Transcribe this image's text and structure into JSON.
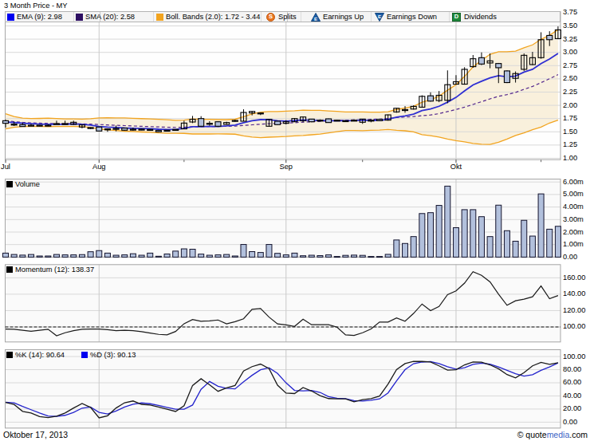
{
  "title": "3 Month Price - MY",
  "price_legend": {
    "ema": {
      "label": "EMA (9): 2.98",
      "color": "#0000f0"
    },
    "sma": {
      "label": "SMA (20): 2.58",
      "color": "#2d0e62"
    },
    "boll": {
      "label": "Boll. Bands (2.0): 1.72 - 3.44",
      "color": "#f2a41f"
    },
    "splits": {
      "label": "Splits"
    },
    "earnings_up": {
      "label": "Earnings Up"
    },
    "earnings_down": {
      "label": "Earnings Down"
    },
    "dividends": {
      "label": "Dividends"
    }
  },
  "footer": {
    "date": "Oktober 17, 2013",
    "copyright": "© ",
    "brand_pre": "quote",
    "brand_mid": "media",
    "brand_post": ".com"
  },
  "colors": {
    "ema_line": "#2f2fd3",
    "sma_line": "#53278d",
    "band_line": "#f2a41f",
    "band_fill": "#f9f0dc",
    "candle_stroke": "#000000",
    "candle_down_fill": "#b2c0dc",
    "volume_fill": "#b2c0dc",
    "volume_stroke": "#14142e",
    "momentum_line": "#1a1a1a",
    "pk_line": "#1a1a1a",
    "pd_line": "#2323cc",
    "grid": "#d9d9d9",
    "month_grid": "#c9c9c9",
    "panel_border": "#a6a6a6"
  },
  "x_axis": {
    "months": [
      {
        "label": "Jul",
        "index": 0
      },
      {
        "label": "Aug",
        "index": 11
      },
      {
        "label": "Sep",
        "index": 33
      },
      {
        "label": "Okt",
        "index": 53
      }
    ],
    "minor_tick_indices": [
      21,
      42,
      63
    ]
  },
  "chart_data": [
    {
      "id": "price",
      "type": "candlestick",
      "title": "3 Month Price - MY",
      "ylim": [
        0.974,
        3.771
      ],
      "yticks": [
        {
          "v": 3.75,
          "label": "3.75"
        },
        {
          "v": 3.5,
          "label": "3.50"
        },
        {
          "v": 3.25,
          "label": "3.25"
        },
        {
          "v": 3.0,
          "label": "3.00"
        },
        {
          "v": 2.75,
          "label": "2.75"
        },
        {
          "v": 2.5,
          "label": "2.50"
        },
        {
          "v": 2.25,
          "label": "2.25"
        },
        {
          "v": 2.0,
          "label": "2.00"
        },
        {
          "v": 1.75,
          "label": "1.75"
        },
        {
          "v": 1.5,
          "label": "1.50"
        },
        {
          "v": 1.25,
          "label": "1.25"
        },
        {
          "v": 1.0,
          "label": "1.00"
        }
      ],
      "ohlc": [
        [
          1.71,
          1.73,
          1.58,
          1.66
        ],
        [
          1.645,
          1.69,
          1.61,
          1.64
        ],
        [
          1.635,
          1.67,
          1.6,
          1.6
        ],
        [
          1.625,
          1.65,
          1.61,
          1.62
        ],
        [
          1.625,
          1.63,
          1.605,
          1.615
        ],
        [
          1.62,
          1.64,
          1.61,
          1.625
        ],
        [
          1.655,
          1.71,
          1.64,
          1.648
        ],
        [
          1.648,
          1.71,
          1.64,
          1.655
        ],
        [
          1.64,
          1.71,
          1.63,
          1.68
        ],
        [
          1.59,
          1.635,
          1.565,
          1.63
        ],
        [
          1.58,
          1.585,
          1.55,
          1.57
        ],
        [
          1.59,
          1.595,
          1.51,
          1.515
        ],
        [
          1.555,
          1.56,
          1.5,
          1.54
        ],
        [
          1.565,
          1.62,
          1.51,
          1.555
        ],
        [
          1.57,
          1.58,
          1.52,
          1.53
        ],
        [
          1.55,
          1.58,
          1.52,
          1.545
        ],
        [
          1.55,
          1.555,
          1.53,
          1.54
        ],
        [
          1.545,
          1.55,
          1.53,
          1.54
        ],
        [
          1.525,
          1.53,
          1.495,
          1.5
        ],
        [
          1.53,
          1.535,
          1.51,
          1.52
        ],
        [
          1.545,
          1.55,
          1.53,
          1.54
        ],
        [
          1.555,
          1.71,
          1.55,
          1.665
        ],
        [
          1.685,
          1.8,
          1.665,
          1.735
        ],
        [
          1.75,
          1.795,
          1.6,
          1.605
        ],
        [
          1.66,
          1.7,
          1.615,
          1.65
        ],
        [
          1.69,
          1.7,
          1.6,
          1.605
        ],
        [
          1.64,
          1.69,
          1.635,
          1.675
        ],
        [
          1.71,
          1.73,
          1.69,
          1.715
        ],
        [
          1.7,
          1.925,
          1.7,
          1.865
        ],
        [
          1.855,
          1.89,
          1.81,
          1.885
        ],
        [
          1.856,
          1.86,
          1.816,
          1.842
        ],
        [
          1.605,
          1.74,
          1.6,
          1.735
        ],
        [
          1.7,
          1.705,
          1.625,
          1.635
        ],
        [
          1.66,
          1.72,
          1.64,
          1.69
        ],
        [
          1.69,
          1.76,
          1.685,
          1.75
        ],
        [
          1.71,
          1.79,
          1.68,
          1.78
        ],
        [
          1.74,
          1.745,
          1.68,
          1.69
        ],
        [
          1.72,
          1.735,
          1.7,
          1.715
        ],
        [
          1.745,
          1.75,
          1.67,
          1.675
        ],
        [
          1.715,
          1.73,
          1.7,
          1.72
        ],
        [
          1.71,
          1.72,
          1.69,
          1.705
        ],
        [
          1.715,
          1.735,
          1.7,
          1.72
        ],
        [
          1.68,
          1.745,
          1.65,
          1.74
        ],
        [
          1.72,
          1.74,
          1.68,
          1.715
        ],
        [
          1.735,
          1.74,
          1.7,
          1.71
        ],
        [
          1.72,
          1.825,
          1.71,
          1.82
        ],
        [
          1.875,
          1.95,
          1.86,
          1.945
        ],
        [
          1.92,
          1.985,
          1.86,
          1.905
        ],
        [
          1.93,
          2.0,
          1.92,
          1.98
        ],
        [
          1.965,
          2.19,
          1.96,
          2.17
        ],
        [
          2.18,
          2.245,
          2.07,
          2.08
        ],
        [
          2.09,
          2.27,
          2.06,
          2.19
        ],
        [
          2.095,
          2.66,
          2.04,
          2.39
        ],
        [
          2.4,
          2.57,
          2.395,
          2.445
        ],
        [
          2.4,
          2.72,
          2.39,
          2.68
        ],
        [
          2.73,
          2.95,
          2.71,
          2.88
        ],
        [
          2.9,
          3.0,
          2.76,
          2.78
        ],
        [
          2.8,
          2.98,
          2.7,
          2.84
        ],
        [
          2.79,
          2.8,
          2.42,
          2.71
        ],
        [
          2.65,
          2.66,
          2.42,
          2.43
        ],
        [
          2.51,
          2.64,
          2.43,
          2.6
        ],
        [
          2.68,
          2.98,
          2.65,
          2.945
        ],
        [
          2.77,
          3.01,
          2.76,
          2.9
        ],
        [
          2.9,
          3.38,
          2.88,
          3.24
        ],
        [
          3.32,
          3.4,
          3.12,
          3.24
        ],
        [
          3.26,
          3.49,
          3.25,
          3.425
        ]
      ],
      "series": [
        {
          "name": "EMA (9)",
          "values": [
            1.685,
            1.677,
            1.662,
            1.654,
            1.646,
            1.641,
            1.641,
            1.643,
            1.648,
            1.643,
            1.625,
            1.6,
            1.588,
            1.582,
            1.572,
            1.567,
            1.563,
            1.56,
            1.549,
            1.545,
            1.543,
            1.566,
            1.597,
            1.596,
            1.604,
            1.601,
            1.612,
            1.628,
            1.671,
            1.709,
            1.73,
            1.729,
            1.708,
            1.703,
            1.711,
            1.724,
            1.716,
            1.716,
            1.708,
            1.71,
            1.71,
            1.713,
            1.72,
            1.718,
            1.715,
            1.735,
            1.776,
            1.8,
            1.834,
            1.9,
            1.933,
            1.982,
            2.06,
            2.15,
            2.272,
            2.386,
            2.455,
            2.52,
            2.56,
            2.537,
            2.553,
            2.629,
            2.68,
            2.788,
            2.875,
            2.98
          ]
        },
        {
          "name": "SMA (20)",
          "values": [
            1.707,
            1.692,
            1.678,
            1.67,
            1.663,
            1.659,
            1.655,
            1.653,
            1.652,
            1.65,
            1.645,
            1.637,
            1.629,
            1.623,
            1.617,
            1.61,
            1.603,
            1.599,
            1.592,
            1.587,
            1.583,
            1.586,
            1.595,
            1.596,
            1.6,
            1.601,
            1.604,
            1.609,
            1.62,
            1.632,
            1.644,
            1.654,
            1.657,
            1.663,
            1.672,
            1.683,
            1.689,
            1.697,
            1.704,
            1.713,
            1.72,
            1.725,
            1.727,
            1.735,
            1.74,
            1.752,
            1.768,
            1.78,
            1.787,
            1.804,
            1.818,
            1.843,
            1.882,
            1.922,
            1.966,
            2.017,
            2.069,
            2.122,
            2.17,
            2.202,
            2.244,
            2.302,
            2.357,
            2.429,
            2.503,
            2.58
          ]
        },
        {
          "name": "Bollinger Upper",
          "values": [
            1.84,
            1.79,
            1.759,
            1.751,
            1.753,
            1.757,
            1.75,
            1.744,
            1.743,
            1.741,
            1.748,
            1.763,
            1.764,
            1.761,
            1.762,
            1.755,
            1.749,
            1.743,
            1.737,
            1.728,
            1.717,
            1.72,
            1.742,
            1.736,
            1.736,
            1.73,
            1.73,
            1.738,
            1.783,
            1.836,
            1.871,
            1.882,
            1.884,
            1.89,
            1.897,
            1.908,
            1.906,
            1.905,
            1.895,
            1.886,
            1.875,
            1.876,
            1.876,
            1.872,
            1.87,
            1.879,
            1.922,
            1.949,
            1.98,
            2.06,
            2.104,
            2.174,
            2.285,
            2.39,
            2.546,
            2.728,
            2.849,
            2.965,
            3.013,
            3.013,
            3.025,
            3.087,
            3.142,
            3.247,
            3.324,
            3.43
          ]
        },
        {
          "name": "Bollinger Lower",
          "values": [
            1.555,
            1.586,
            1.601,
            1.603,
            1.6,
            1.598,
            1.599,
            1.6,
            1.6,
            1.597,
            1.58,
            1.55,
            1.536,
            1.526,
            1.512,
            1.505,
            1.497,
            1.491,
            1.479,
            1.473,
            1.471,
            1.47,
            1.459,
            1.459,
            1.459,
            1.46,
            1.459,
            1.455,
            1.424,
            1.4,
            1.39,
            1.399,
            1.405,
            1.411,
            1.422,
            1.431,
            1.444,
            1.457,
            1.479,
            1.503,
            1.525,
            1.524,
            1.52,
            1.529,
            1.531,
            1.544,
            1.528,
            1.519,
            1.5,
            1.447,
            1.426,
            1.4,
            1.363,
            1.332,
            1.311,
            1.28,
            1.266,
            1.26,
            1.304,
            1.364,
            1.43,
            1.48,
            1.541,
            1.589,
            1.666,
            1.72
          ]
        }
      ]
    },
    {
      "id": "volume",
      "type": "bar",
      "legend": "Volume",
      "ylim": [
        0,
        6.23
      ],
      "yticks": [
        {
          "v": 6,
          "label": "6.00m"
        },
        {
          "v": 5,
          "label": "5.00m"
        },
        {
          "v": 4,
          "label": "4.00m"
        },
        {
          "v": 3,
          "label": "3.00m"
        },
        {
          "v": 2,
          "label": "2.00m"
        },
        {
          "v": 1,
          "label": "1.00m"
        },
        {
          "v": 0,
          "label": "0.00"
        }
      ],
      "values": [
        0.32,
        0.21,
        0.16,
        0.21,
        0.09,
        0.09,
        0.21,
        0.18,
        0.18,
        0.2,
        0.43,
        0.52,
        0.32,
        0.15,
        0.18,
        0.27,
        0.15,
        0.32,
        0.07,
        0.25,
        0.48,
        0.66,
        0.63,
        0.24,
        0.15,
        0.18,
        0.21,
        0.09,
        1.01,
        0.44,
        0.37,
        1.01,
        0.3,
        0.18,
        0.32,
        0.11,
        0.15,
        0.12,
        0.18,
        0.05,
        0.14,
        0.16,
        0.14,
        0.05,
        0.05,
        0.22,
        1.37,
        1.09,
        1.64,
        3.48,
        3.55,
        4.13,
        5.67,
        2.35,
        3.79,
        3.79,
        3.23,
        1.64,
        4.15,
        2.11,
        1.27,
        2.94,
        1.68,
        5.05,
        2.23,
        2.46
      ]
    },
    {
      "id": "momentum",
      "type": "line",
      "legend": "Momentum (12): 138.37",
      "ylim": [
        81.7,
        176.1
      ],
      "ref_line": 100,
      "yticks": [
        {
          "v": 160,
          "label": "160.00"
        },
        {
          "v": 140,
          "label": "140.00"
        },
        {
          "v": 120,
          "label": "120.00"
        },
        {
          "v": 100,
          "label": "100.00"
        }
      ],
      "values": [
        97.4,
        97.2,
        95.9,
        94.7,
        95.9,
        97.2,
        89.2,
        92.9,
        95.5,
        97.2,
        97.4,
        97.4,
        96.7,
        95.5,
        95.9,
        95.5,
        94.2,
        92.5,
        91.0,
        90.4,
        94.5,
        104.0,
        109.0,
        107.0,
        107.5,
        108.5,
        103.8,
        106.5,
        110.0,
        121.5,
        122.5,
        112.0,
        103.7,
        102.6,
        100.7,
        109.5,
        102.7,
        102.7,
        102.7,
        99.8,
        90.3,
        89.6,
        92.9,
        97.5,
        106.0,
        106.0,
        111.0,
        107.0,
        116.5,
        128.0,
        120.0,
        125.0,
        139.5,
        144.0,
        153.5,
        167.5,
        163.0,
        155.0,
        140.0,
        126.5,
        132.0,
        134.0,
        136.8,
        150.0,
        134.5,
        138.37
      ]
    },
    {
      "id": "stochastic",
      "type": "line",
      "ylim": [
        -9.0,
        110.4
      ],
      "yticks": [
        {
          "v": 100,
          "label": "100.00"
        },
        {
          "v": 80,
          "label": "80.00"
        },
        {
          "v": 60,
          "label": "60.00"
        },
        {
          "v": 40,
          "label": "40.00"
        },
        {
          "v": 20,
          "label": "20.00"
        },
        {
          "v": 0,
          "label": "0.00"
        }
      ],
      "series": [
        {
          "name": "%K (14): 90.64",
          "values": [
            30.0,
            27.0,
            16.5,
            14.0,
            8.5,
            7.0,
            9.0,
            14.0,
            21.5,
            28.4,
            22.5,
            6.6,
            9.8,
            21.6,
            29.6,
            32.3,
            27.2,
            26.2,
            23.0,
            19.8,
            16.3,
            25.1,
            55.9,
            66.2,
            57.0,
            47.0,
            52.3,
            55.8,
            78.0,
            84.6,
            88.5,
            81.6,
            56.3,
            44.3,
            43.6,
            52.8,
            47.5,
            40.5,
            36.0,
            35.5,
            35.5,
            31.0,
            34.2,
            35.9,
            39.7,
            58.1,
            80.0,
            89.3,
            92.5,
            92.5,
            91.8,
            85.8,
            79.3,
            79.9,
            87.3,
            91.6,
            91.4,
            87.3,
            81.4,
            72.5,
            67.5,
            75.4,
            85.8,
            91.0,
            88.2,
            90.64
          ]
        },
        {
          "name": "%D (3): 90.13",
          "values": [
            30.5,
            29.5,
            24.0,
            19.0,
            14.0,
            9.5,
            8.8,
            10.5,
            15.0,
            21.4,
            23.0,
            15.0,
            12.5,
            17.0,
            23.0,
            27.4,
            29.3,
            28.1,
            25.5,
            22.6,
            19.8,
            19.8,
            26.1,
            50.0,
            62.0,
            54.7,
            51.6,
            50.7,
            61.5,
            71.4,
            79.9,
            82.9,
            74.2,
            59.9,
            48.4,
            47.7,
            48.4,
            45.4,
            39.0,
            36.4,
            35.9,
            32.7,
            32.2,
            33.4,
            35.4,
            44.6,
            63.0,
            80.0,
            89.1,
            91.6,
            92.3,
            89.4,
            84.4,
            80.8,
            82.9,
            88.2,
            90.0,
            88.5,
            84.1,
            79.0,
            73.7,
            70.1,
            72.2,
            79.0,
            84.1,
            90.13
          ]
        }
      ]
    }
  ]
}
